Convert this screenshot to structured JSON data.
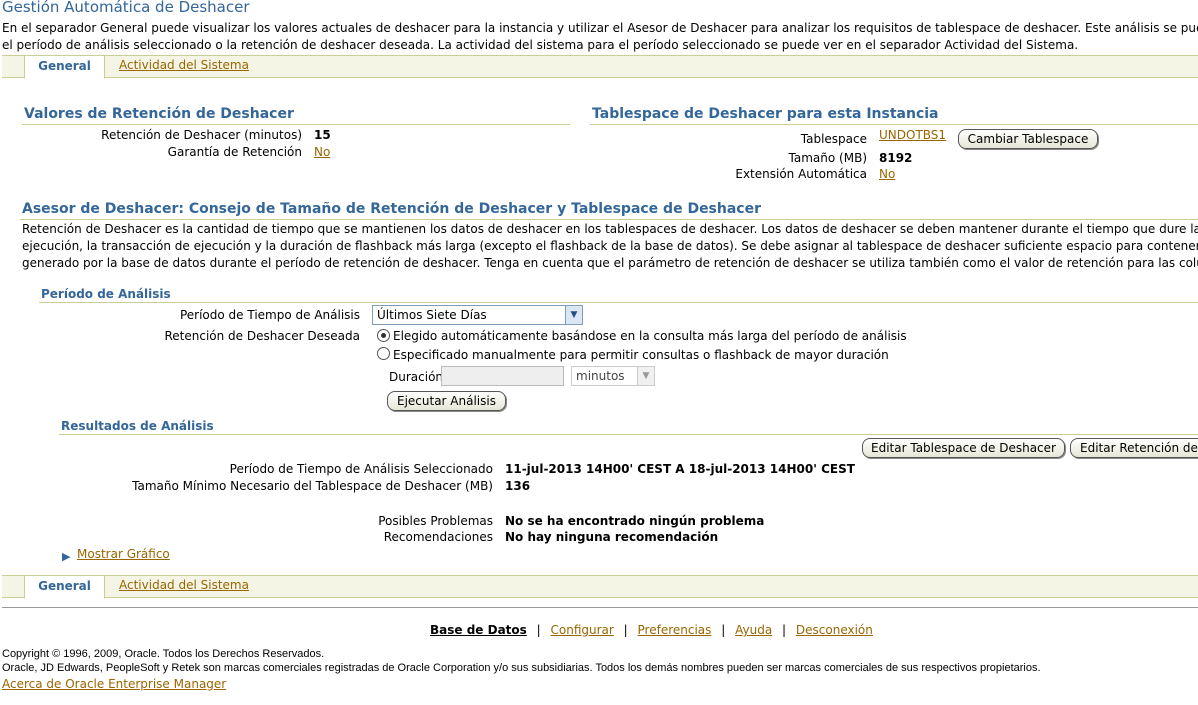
{
  "page": {
    "title": "Gestión Automática de Deshacer",
    "intro_line1": "En el separador General puede visualizar los valores actuales de deshacer para la instancia y utilizar el Asesor de Deshacer para analizar los requisitos de tablespace de deshacer. Este análisis se puede rea",
    "intro_line2": "el período de análisis seleccionado o la retención de deshacer deseada. La actividad del sistema para el período seleccionado se puede ver en el separador Actividad del Sistema."
  },
  "tabs": {
    "general": "General",
    "activity": "Actividad del Sistema"
  },
  "retention": {
    "heading": "Valores de Retención de Deshacer",
    "retention_label": "Retención de Deshacer (minutos)",
    "retention_value": "15",
    "guarantee_label": "Garantía de Retención",
    "guarantee_value": "No"
  },
  "tablespace": {
    "heading": "Tablespace de Deshacer para esta Instancia",
    "tablespace_label": "Tablespace",
    "tablespace_value": "UNDOTBS1",
    "change_button": "Cambiar Tablespace",
    "size_label": "Tamaño (MB)",
    "size_value": "8192",
    "autoextend_label": "Extensión Automática",
    "autoextend_value": "No"
  },
  "advisor": {
    "heading": "Asesor de Deshacer: Consejo de Tamaño de Retención de Deshacer y Tablespace de Deshacer",
    "text_line1": "Retención de Deshacer es la cantidad de tiempo que se mantienen los datos de deshacer en los tablespaces de deshacer. Los datos de deshacer se deben mantener durante el tiempo que dure la consul",
    "text_line2": "ejecución, la transacción de ejecución y la duración de flashback más larga (excepto el flashback de la base de datos). Se debe asignar al tablespace de deshacer suficiente espacio para contener el resu",
    "text_line3": "generado por la base de datos durante el período de retención de deshacer. Tenga en cuenta que el parámetro de retención de deshacer se utiliza también como el valor de retención para las columnas LO"
  },
  "analysis": {
    "heading": "Período de Análisis",
    "period_label": "Período de Tiempo de Análisis",
    "period_value": "Últimos Siete Días",
    "desired_label": "Retención de Deshacer Deseada",
    "option_auto": "Elegido automáticamente basándose en la consulta más larga del período de análisis",
    "option_manual": "Especificado manualmente para permitir consultas o flashback de mayor duración",
    "duration_label": "Duración",
    "duration_value": "",
    "unit_value": "minutos",
    "run_button": "Ejecutar Análisis"
  },
  "results": {
    "heading": "Resultados de Análisis",
    "edit_tablespace_button": "Editar Tablespace de Deshacer",
    "edit_retention_button": "Editar Retención de",
    "period_label": "Período de Tiempo de Análisis Seleccionado",
    "period_value": "11-jul-2013 14H00' CEST A 18-jul-2013 14H00' CEST",
    "minsize_label": "Tamaño Mínimo Necesario del Tablespace de Deshacer (MB)",
    "minsize_value": "136",
    "problems_label": "Posibles Problemas",
    "problems_value": "No se ha encontrado ningún problema",
    "recs_label": "Recomendaciones",
    "recs_value": "No hay ninguna recomendación",
    "show_graph": "Mostrar Gráfico"
  },
  "footer": {
    "links": [
      "Base de Datos",
      "Configurar",
      "Preferencias",
      "Ayuda",
      "Desconexión"
    ],
    "separator": "|",
    "copyright": "Copyright © 1996, 2009, Oracle. Todos los Derechos Reservados.",
    "trademark": "Oracle, JD Edwards, PeopleSoft y Retek son marcas comerciales registradas de Oracle Corporation y/o sus subsidiarias. Todos los demás nombres pueden ser marcas comerciales de sus respectivos propietarios.",
    "about": "Acerca de Oracle Enterprise Manager"
  },
  "colors": {
    "heading": "#336699",
    "link": "#996600",
    "tab_border": "#cccc99"
  }
}
